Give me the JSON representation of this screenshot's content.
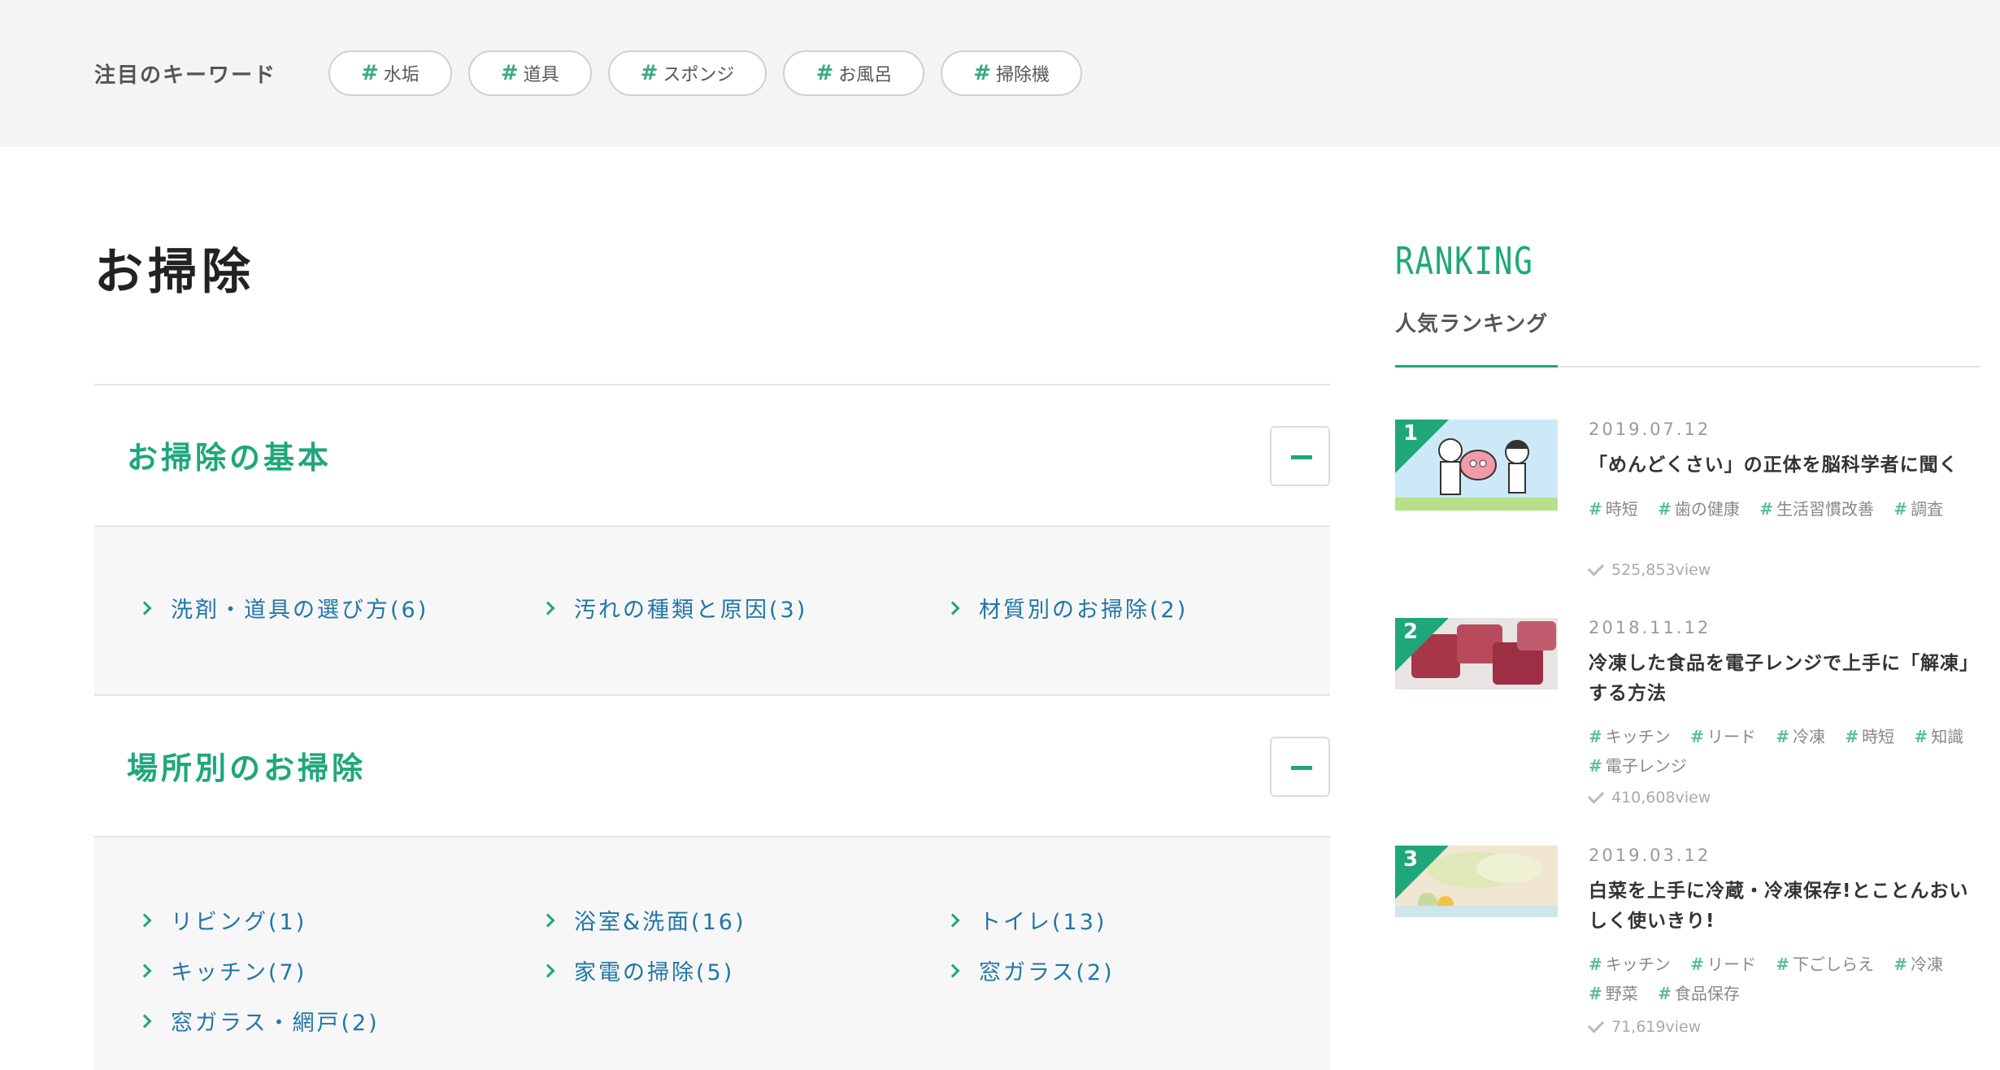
{
  "keyword_bar": {
    "title": "注目のキーワード",
    "tags": [
      "水垢",
      "道具",
      "スポンジ",
      "お風呂",
      "掃除機"
    ]
  },
  "page": {
    "title": "お掃除"
  },
  "sections": [
    {
      "title": "お掃除の基本",
      "links": [
        "洗剤・道具の選び方(6)",
        "汚れの種類と原因(3)",
        "材質別のお掃除(2)"
      ]
    },
    {
      "title": "場所別のお掃除",
      "links": [
        "リビング(1)",
        "浴室&洗面(16)",
        "トイレ(13)",
        "キッチン(7)",
        "家電の掃除(5)",
        "窓ガラス(2)",
        "窓ガラス・網戸(2)"
      ]
    }
  ],
  "ranking": {
    "heading_en": "RANKING",
    "heading_jp": "人気ランキング",
    "items": [
      {
        "rank": "1",
        "date": "2019.07.12",
        "title": "「めんどくさい」の正体を脳科学者に聞く",
        "tags": [
          "時短",
          "歯の健康",
          "生活習慣改善",
          "調査"
        ],
        "views": "525,853view"
      },
      {
        "rank": "2",
        "date": "2018.11.12",
        "title": "冷凍した食品を電子レンジで上手に「解凍」する方法",
        "tags": [
          "キッチン",
          "リード",
          "冷凍",
          "時短",
          "知識",
          "電子レンジ"
        ],
        "views": "410,608view"
      },
      {
        "rank": "3",
        "date": "2019.03.12",
        "title": "白菜を上手に冷蔵・冷凍保存!とことんおいしく使いきり!",
        "tags": [
          "キッチン",
          "リード",
          "下ごしらえ",
          "冷凍",
          "野菜",
          "食品保存"
        ],
        "views": "71,619view"
      }
    ]
  },
  "colors": {
    "accent": "#1ea77a",
    "link": "#2176a8"
  }
}
